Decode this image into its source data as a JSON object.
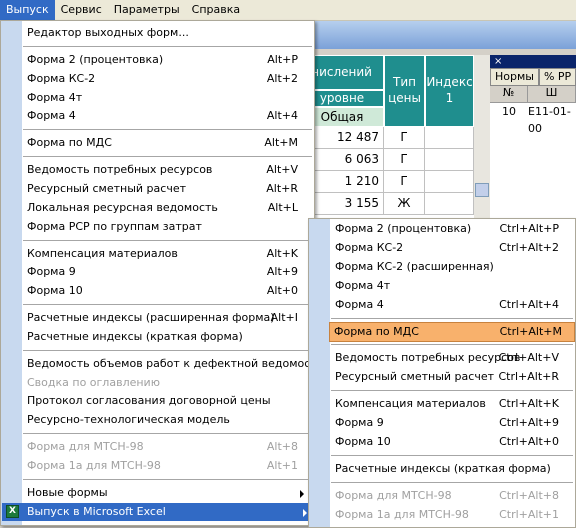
{
  "menubar": [
    "Выпуск",
    "Сервис",
    "Параметры",
    "Справка"
  ],
  "grid": {
    "headers": {
      "calc": "числений",
      "level": "уровне",
      "total": "Общая",
      "price_type": "Тип цены",
      "index": "Индекс 1"
    },
    "rows": [
      {
        "total": "12 487",
        "type": "Г"
      },
      {
        "total": "6 063",
        "type": "Г"
      },
      {
        "total": "1 210",
        "type": "Г"
      },
      {
        "total": "3 155",
        "type": "Ж"
      }
    ]
  },
  "right_panel": {
    "close": "×",
    "tabs": [
      "Нормы",
      "% РР"
    ],
    "columns": [
      "№",
      "Ш"
    ],
    "row": {
      "num": "10",
      "code": "Е11-01-00"
    }
  },
  "main_menu": [
    {
      "label": "Редактор выходных форм..."
    },
    {
      "sep": true
    },
    {
      "label": "Форма 2 (процентовка)",
      "shortcut": "Alt+P"
    },
    {
      "label": "Форма КС-2",
      "shortcut": "Alt+2"
    },
    {
      "label": "Форма 4т"
    },
    {
      "label": "Форма 4",
      "shortcut": "Alt+4"
    },
    {
      "sep": true
    },
    {
      "label": "Форма по МДС",
      "shortcut": "Alt+M"
    },
    {
      "sep": true
    },
    {
      "label": "Ведомость потребных ресурсов",
      "shortcut": "Alt+V"
    },
    {
      "label": "Ресурсный сметный расчет",
      "shortcut": "Alt+R"
    },
    {
      "label": "Локальная ресурсная ведомость",
      "shortcut": "Alt+L"
    },
    {
      "label": "Форма РСР по группам затрат"
    },
    {
      "sep": true
    },
    {
      "label": "Компенсация материалов",
      "shortcut": "Alt+K"
    },
    {
      "label": "Форма 9",
      "shortcut": "Alt+9"
    },
    {
      "label": "Форма 10",
      "shortcut": "Alt+0"
    },
    {
      "sep": true
    },
    {
      "label": "Расчетные индексы (расширенная форма)",
      "shortcut": "Alt+I"
    },
    {
      "label": "Расчетные индексы (краткая форма)"
    },
    {
      "sep": true
    },
    {
      "label": "Ведомость объемов работ к дефектной ведомости"
    },
    {
      "label": "Сводка по оглавлению",
      "disabled": true
    },
    {
      "label": "Протокол согласования договорной цены"
    },
    {
      "label": "Ресурсно-технологическая модель"
    },
    {
      "sep": true
    },
    {
      "label": "Форма для МТСН-98",
      "shortcut": "Alt+8",
      "disabled": true
    },
    {
      "label": "Форма 1а для МТСН-98",
      "shortcut": "Alt+1",
      "disabled": true
    },
    {
      "sep": true
    },
    {
      "label": "Новые формы",
      "submenu": true
    },
    {
      "label": "Выпуск в Microsoft Excel",
      "submenu": true,
      "highlight": true,
      "icon": "excel-icon"
    }
  ],
  "sub_menu": [
    {
      "label": "Форма 2 (процентовка)",
      "shortcut": "Ctrl+Alt+P"
    },
    {
      "label": "Форма КС-2",
      "shortcut": "Ctrl+Alt+2"
    },
    {
      "label": "Форма КС-2 (расширенная)"
    },
    {
      "label": "Форма 4т"
    },
    {
      "label": "Форма 4",
      "shortcut": "Ctrl+Alt+4"
    },
    {
      "sep": true
    },
    {
      "label": "Форма по МДС",
      "shortcut": "Ctrl+Alt+M",
      "highlight": true
    },
    {
      "sep": true
    },
    {
      "label": "Ведомость потребных ресурсов",
      "shortcut": "Ctrl+Alt+V"
    },
    {
      "label": "Ресурсный сметный расчет",
      "shortcut": "Ctrl+Alt+R"
    },
    {
      "sep": true
    },
    {
      "label": "Компенсация материалов",
      "shortcut": "Ctrl+Alt+K"
    },
    {
      "label": "Форма 9",
      "shortcut": "Ctrl+Alt+9"
    },
    {
      "label": "Форма 10",
      "shortcut": "Ctrl+Alt+0"
    },
    {
      "sep": true
    },
    {
      "label": "Расчетные индексы (краткая форма)"
    },
    {
      "sep": true
    },
    {
      "label": "Форма для МТСН-98",
      "shortcut": "Ctrl+Alt+8",
      "disabled": true
    },
    {
      "label": "Форма 1а для МТСН-98",
      "shortcut": "Ctrl+Alt+1",
      "disabled": true
    }
  ],
  "colors": {
    "highlight_orange": "#f8b16c",
    "menu_select_blue": "#316ac5",
    "grid_header_teal": "#1f8e8e",
    "menu_strip": "#c8d9ef"
  }
}
